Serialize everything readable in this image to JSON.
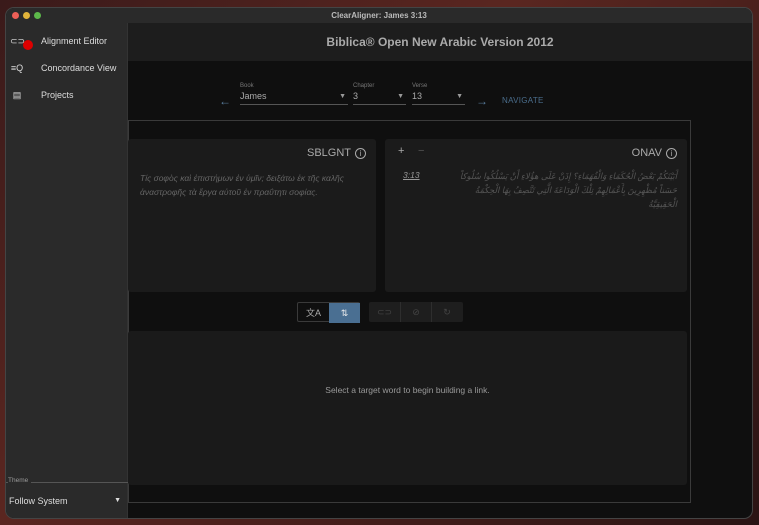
{
  "window": {
    "title": "ClearAligner: James 3:13",
    "header": "Biblica® Open New Arabic Version 2012"
  },
  "drawer": {
    "items": [
      {
        "label": "Alignment Editor",
        "icon": "link-add-icon"
      },
      {
        "label": "Concordance View",
        "icon": "search-list-icon"
      },
      {
        "label": "Projects",
        "icon": "library-books-icon"
      }
    ],
    "theme_label": "Theme",
    "theme_value": "Follow System"
  },
  "navigation": {
    "book_label": "Book",
    "book": "James",
    "chapter_label": "Chapter",
    "chapter": "3",
    "verse_label": "Verse",
    "verse": "13",
    "navigate": "NAVIGATE"
  },
  "source": {
    "title": "SBLGNT",
    "text": "Τίς σοφὸς καὶ ἐπιστήμων ἐν ὑμῖν; δειξάτω ἐκ τῆς καλῆς ἀναστροφῆς τὰ ἔργα αὐτοῦ ἐν πραΰτητι σοφίας."
  },
  "target": {
    "title": "ONAV",
    "plus": "+",
    "minus": "−",
    "ref": "3:13",
    "text": "أَبَيْنَكُمْ بَعْضُ الْحُكَمَاءِ وَالْفُهَمَاءِ؟ إِذَنْ عَلَى هؤُلاءِ أَنْ يَسْلُكُوا سُلُوكاً حَسَناً مُظْهِرِينَ بِأَعْمَالِهِمْ تِلْكَ الْوَدَاعَةَ الَّتِي تَتَّصِفُ بِهَا الْحِكْمَةُ الْحَقِيقِيَّةُ"
  },
  "link_panel": {
    "message": "Select a target word to begin building a link."
  },
  "colors": {
    "accent": "#5a7fa0",
    "active_toggle": "#4a6f92"
  }
}
